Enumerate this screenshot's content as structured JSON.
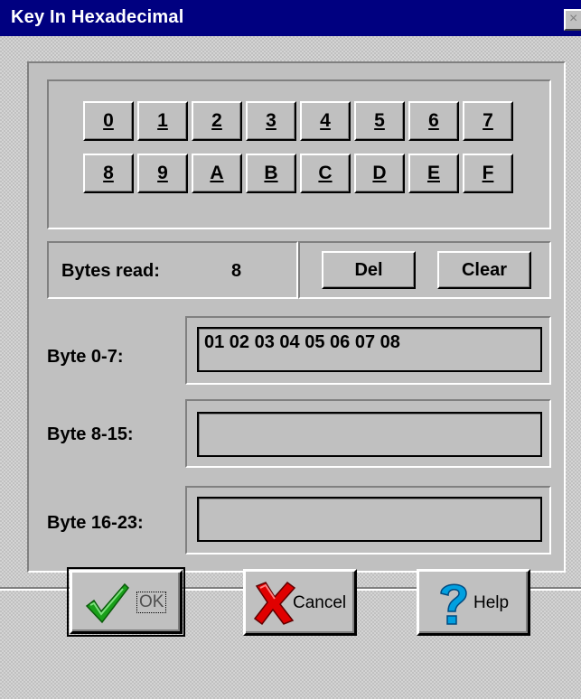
{
  "window": {
    "title": "Key In Hexadecimal",
    "close_glyph": "×"
  },
  "keypad": {
    "row1": [
      "0",
      "1",
      "2",
      "3",
      "4",
      "5",
      "6",
      "7"
    ],
    "row2": [
      "8",
      "9",
      "A",
      "B",
      "C",
      "D",
      "E",
      "F"
    ]
  },
  "status": {
    "bytes_read_label": "Bytes read:",
    "bytes_read_value": "8",
    "del_label": "Del",
    "clear_label": "Clear"
  },
  "bytes": {
    "row0": {
      "label": "Byte 0-7:",
      "value": "01 02 03 04 05 06 07 08"
    },
    "row1": {
      "label": "Byte 8-15:",
      "value": ""
    },
    "row2": {
      "label": "Byte 16-23:",
      "value": ""
    }
  },
  "footer": {
    "ok_label": "OK",
    "cancel_label": "Cancel",
    "help_label": "Help"
  },
  "colors": {
    "titlebar": "#000080",
    "face": "#c0c0c0",
    "ok_check": "#1aa01a",
    "cancel_x": "#e00000",
    "help_q": "#00a0e0"
  },
  "icons": {
    "ok": "check-icon",
    "cancel": "x-icon",
    "help": "question-icon"
  }
}
